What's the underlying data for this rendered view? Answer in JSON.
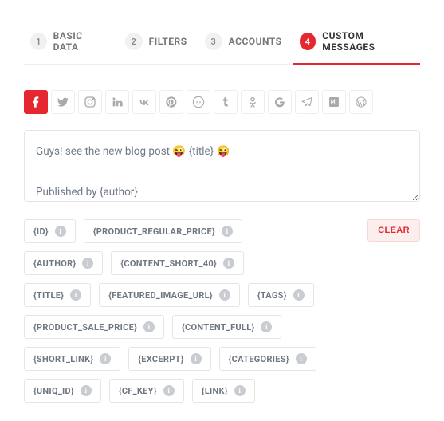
{
  "tabs": [
    {
      "num": "1",
      "label": "BASIC DATA"
    },
    {
      "num": "2",
      "label": "FILTERS"
    },
    {
      "num": "3",
      "label": "ACCOUNTS"
    },
    {
      "num": "4",
      "label": "CUSTOM MESSAGES"
    }
  ],
  "active_tab": 3,
  "socials": [
    "facebook",
    "twitter",
    "instagram",
    "linkedin",
    "vk",
    "pinterest",
    "reddit",
    "tumblr",
    "odnoklassniki",
    "google",
    "telegram",
    "medium",
    "wordpress"
  ],
  "active_social": 0,
  "message": "Guys! see the new blog post 😜 {title} 😜\n\nPublished by {author}",
  "clear_label": "CLEAR",
  "tag_rows": [
    [
      "{ID}",
      "{PRODUCT_REGULAR_PRICE}"
    ],
    [
      "{AUTHOR}",
      "{CONTENT_SHORT_40}"
    ],
    [
      "{TITLE}",
      "{FEATURED_IMAGE_URL}",
      "{TAGS}"
    ],
    [
      "{PRODUCT_SALE_PRICE}",
      "{CONTENT_FULL}"
    ],
    [
      "{SHORT_LINK}",
      "{EXCERPT}",
      "{CATEGORIES}"
    ],
    [
      "{UNIQ_ID}",
      "{CF_KEY}",
      "{LINK}"
    ]
  ],
  "info_glyph": "i"
}
